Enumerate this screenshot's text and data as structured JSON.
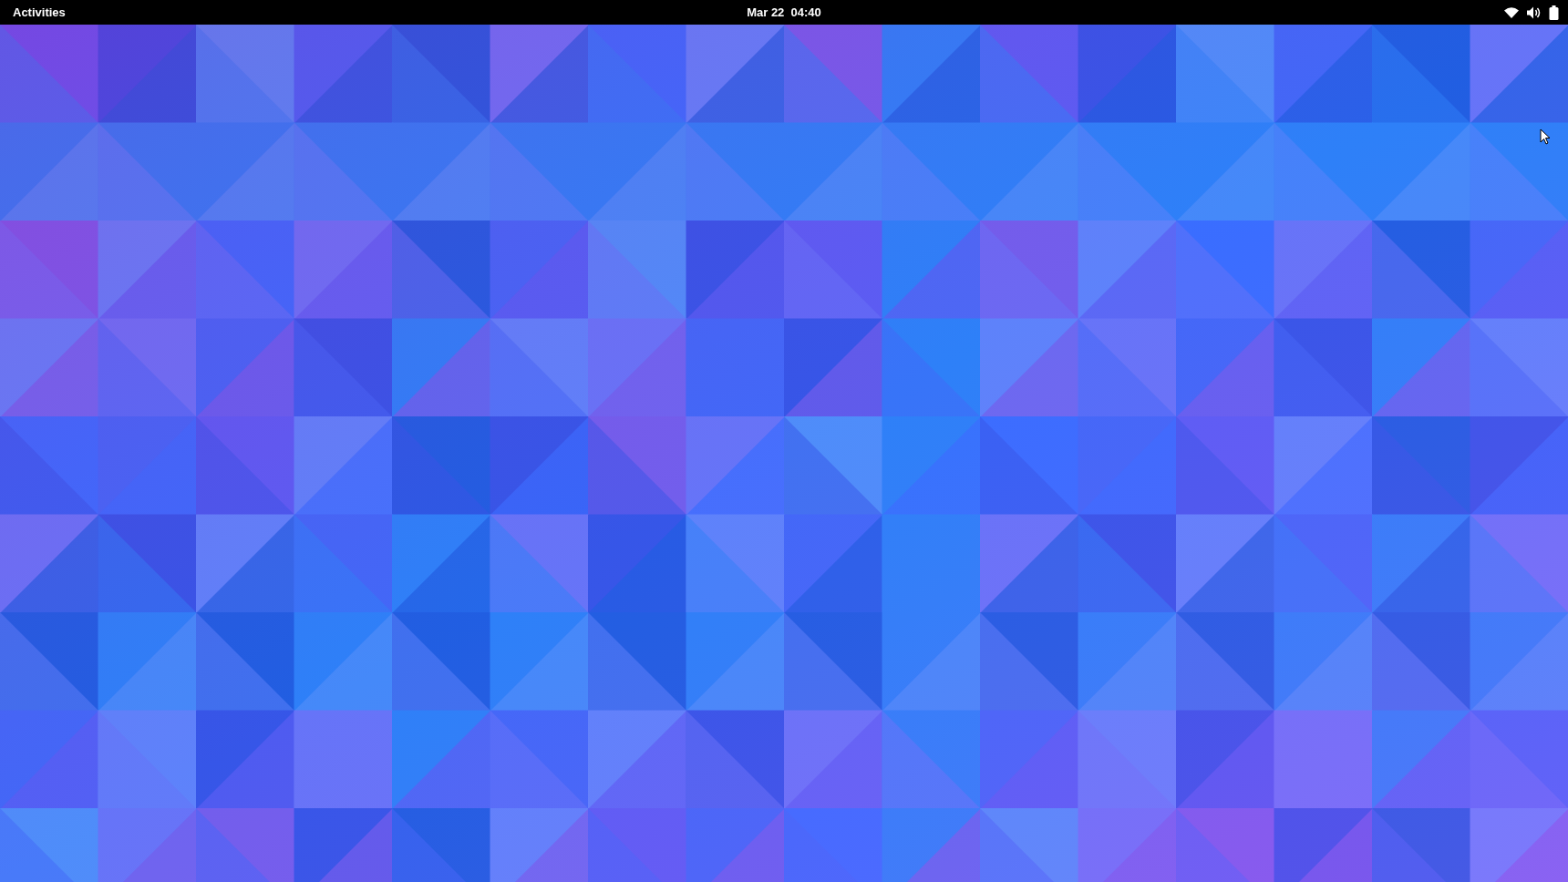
{
  "top_bar": {
    "activities": "Activities",
    "clock": "Mar 22  04:40"
  }
}
